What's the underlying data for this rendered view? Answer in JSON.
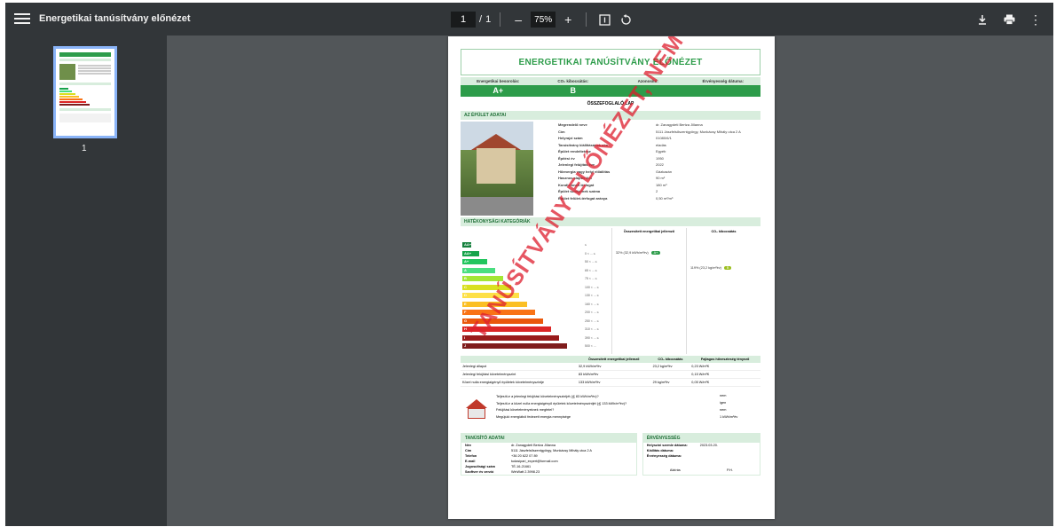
{
  "viewer": {
    "title": "Energetikai tanúsítvány előnézet",
    "page_current": "1",
    "page_separator": "/",
    "page_total": "1",
    "zoom": "75%",
    "thumbnail_page_number": "1",
    "icons": {
      "menu": "hamburger-menu-icon",
      "zoom_out": "minus-icon",
      "zoom_in": "plus-icon",
      "fit": "fit-page-icon",
      "rotate": "rotate-icon",
      "download": "download-icon",
      "print": "print-icon",
      "more": "more-vert-icon"
    }
  },
  "document": {
    "banner_title": "ENERGETIKAI TANÚSÍTVÁNY ELŐNÉZET",
    "ratings": [
      {
        "header": "Energetikai besorolás:",
        "value": "A+"
      },
      {
        "header": "CO₂ kibocsátás:",
        "value": "B"
      },
      {
        "header": "Azonosító:",
        "value": ""
      },
      {
        "header": "Érvényesség dátuma:",
        "value": ""
      }
    ],
    "summary_title": "ÖSSZEFOGLALÓ LAP",
    "section_building": "AZ ÉPÜLET ADATAI",
    "building_facts": [
      {
        "key": "Megrendelő neve",
        "value": "dr. Zanagydeti Bertza Jillanna"
      },
      {
        "key": "Cím",
        "value": "5111 Jászfelsőszentgyörgy, Munkácsy Mihály utca 2 A"
      },
      {
        "key": "Helyrajzi szám",
        "value": "01080/6/1"
      },
      {
        "key": "Tanúsítvány kiállításának oka",
        "value": "eladás"
      },
      {
        "key": "Épület rendeltetése",
        "value": "Egyéb"
      },
      {
        "key": "Építési év",
        "value": "1950"
      },
      {
        "key": "Jelenlegi felújítás éve",
        "value": "2022"
      },
      {
        "key": "Hőenergia vagy helyi előállítás",
        "value": "Gázkazán"
      },
      {
        "key": "Hasznos alapterület",
        "value": "90 m²"
      },
      {
        "key": "Kondicionált térfogat",
        "value": "180 m³"
      },
      {
        "key": "Épület szintjeinek száma",
        "value": "2"
      },
      {
        "key": "Épület felület-térfogat aránya",
        "value": "0,50 m²/m³"
      }
    ],
    "section_efficiency": "HATÉKONYSÁGI KATEGÓRIÁK",
    "col_energy": "Összesített energetikai jellemző",
    "col_co2": "CO₂ kibocsátás",
    "scale": [
      {
        "label": "AA++",
        "range": "≤",
        "color": "#15803d"
      },
      {
        "label": "AA+",
        "range": "0 < ... ≤",
        "color": "#16a34a"
      },
      {
        "label": "A+",
        "range": "50 < ... ≤",
        "color": "#22c55e"
      },
      {
        "label": "A",
        "range": "65 < ... ≤",
        "color": "#4ade80"
      },
      {
        "label": "B",
        "range": "75 < ... ≤",
        "color": "#a3e635"
      },
      {
        "label": "C",
        "range": "100 < ... ≤",
        "color": "#d9e021"
      },
      {
        "label": "D",
        "range": "130 < ... ≤",
        "color": "#fde047"
      },
      {
        "label": "E",
        "range": "160 < ... ≤",
        "color": "#fbbf24"
      },
      {
        "label": "F",
        "range": "200 < ... ≤",
        "color": "#f97316"
      },
      {
        "label": "G",
        "range": "250 < ... ≤",
        "color": "#ea580c"
      },
      {
        "label": "H",
        "range": "310 < ... ≤",
        "color": "#dc2626"
      },
      {
        "label": "I",
        "range": "390 < ... ≤",
        "color": "#991b1b"
      },
      {
        "label": "J",
        "range": "500 < ...",
        "color": "#7f1d1d"
      }
    ],
    "mark_energy": "32% (32,9 kWh/m²év)",
    "mark_energy_chip": "A+",
    "mark_co2": "119% (23,2 kg/m²év)",
    "mark_co2_chip": "B",
    "summary_table": {
      "headers": [
        "",
        "Összesített energetikai jellemző",
        "CO₂ kibocsátás",
        "Fajlagos hőveszteség tényező"
      ],
      "rows": [
        [
          "Jelenlegi állapot",
          "32,9 kWh/m²év",
          "23,2 kg/m²év",
          "0,23 W/m²K"
        ],
        [
          "Jelenlegi felújítási követelményszint",
          "83 kWh/m²év",
          "",
          "0,15 W/m²K"
        ],
        [
          "Közel nulla energiaigényű épületek követelményszintje",
          "133 kWh/m²év",
          "29 kg/m²év",
          "0,05 W/m²K"
        ]
      ]
    },
    "requirements": [
      {
        "q": "Teljesíti-e a jelenlegi felújítási követelményszintjét (≦ 83 kWh/m²év)?",
        "a": "nem"
      },
      {
        "q": "Teljesíti-e a közel nulla energiaigényű épületek követelményszintjét (≦ 133 kWh/m²év)?",
        "a": "igen"
      },
      {
        "q": "Felújítási követelményeknek megfelel?",
        "a": "nem"
      },
      {
        "q": "Megújuló energiából fedezett energia mennyisége",
        "a": "1 kWh/m²év"
      }
    ],
    "expert_title": "TANÚSÍTÓ ADATAI",
    "expert": [
      {
        "key": "Név",
        "value": "dr. Zanagydeti Bertza Jillanna"
      },
      {
        "key": "Cím",
        "value": "5111 Jászfelsőszentgyörgy, Munkácsy Mihály utca 2 A"
      },
      {
        "key": "Telefon",
        "value": "+36 20 622 07 89"
      },
      {
        "key": "E-mail",
        "value": "tudasipari_expert@formail.com"
      },
      {
        "key": "Jogosultsági szám",
        "value": "TÉ-16-21661"
      },
      {
        "key": "Szoftver és verzió",
        "value": "WinWatt 2.3998.23"
      }
    ],
    "validity_title": "ÉRVÉNYESSÉG",
    "validity": [
      {
        "key": "Helyszíni szemle dátuma:",
        "value": "2023.03.20."
      },
      {
        "key": "Kiállítás dátuma:",
        "value": ""
      },
      {
        "key": "Érvényesség dátuma:",
        "value": ""
      }
    ],
    "signature_left": "Aláírás",
    "signature_right": "P.H.",
    "watermark": "TANÚSÍTVÁNY ELŐNÉZET, NEM HITELES"
  }
}
